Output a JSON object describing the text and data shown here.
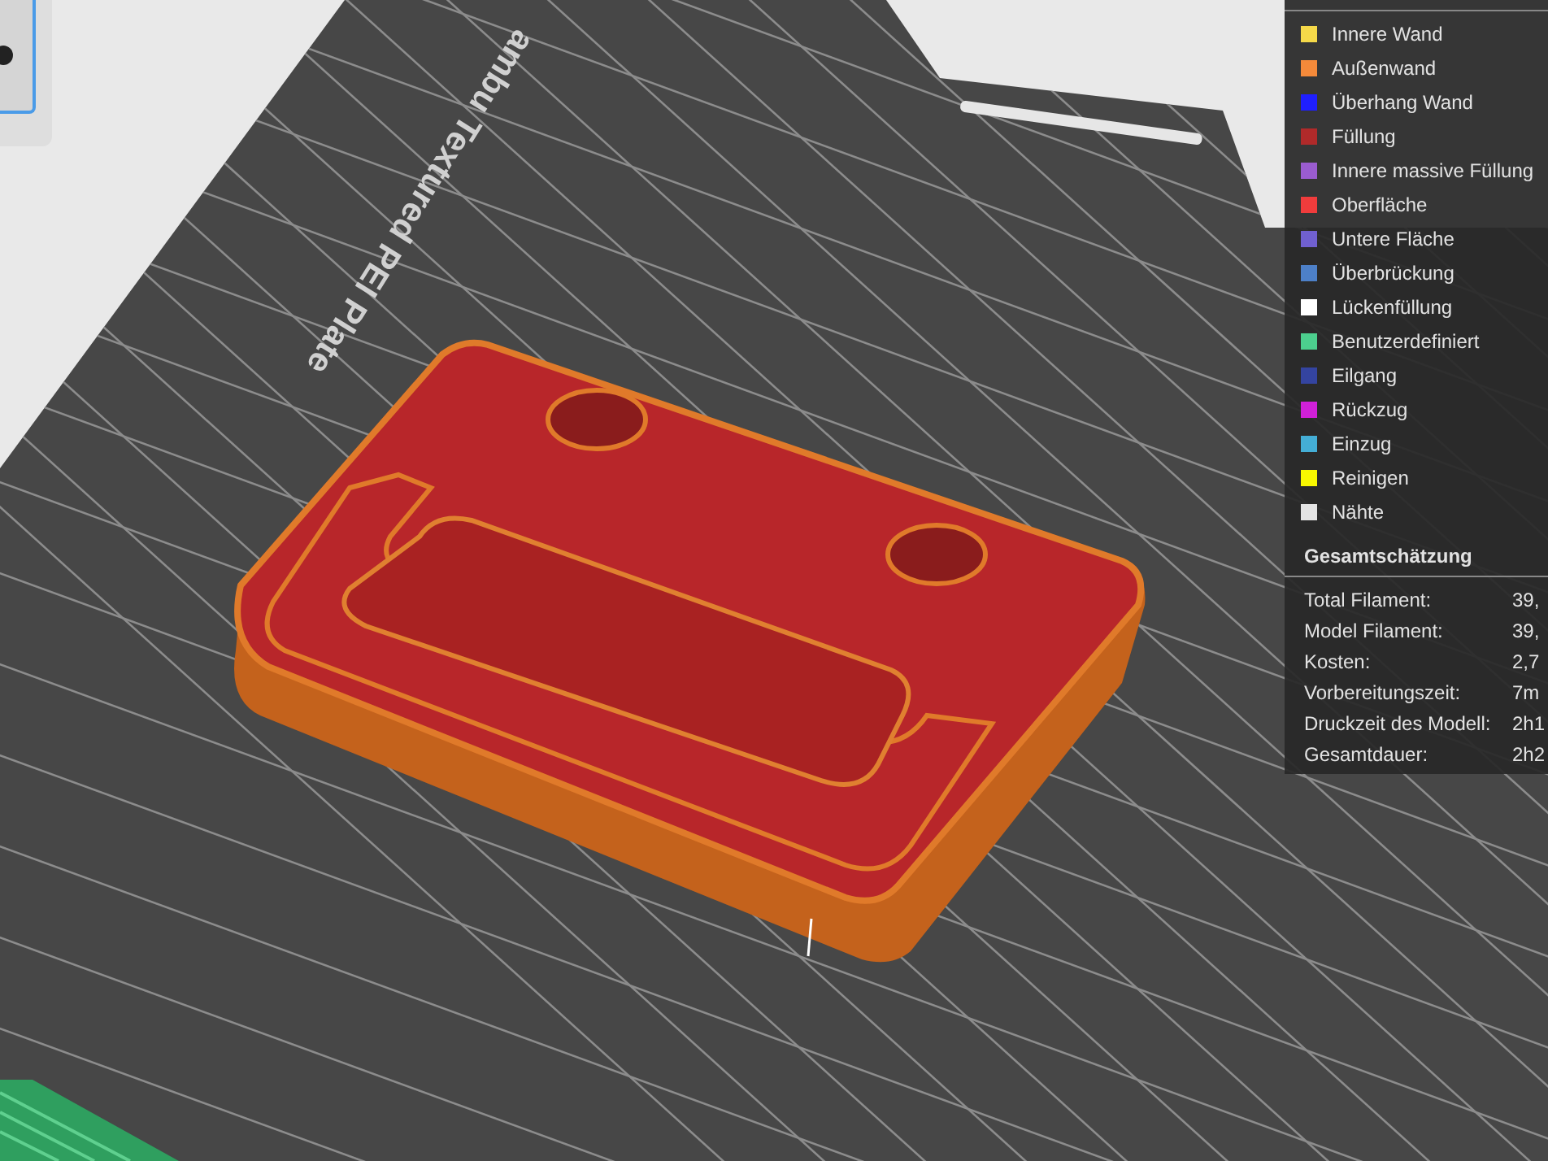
{
  "plate": {
    "label": "ambu Textured PEI Plate"
  },
  "legend": {
    "items": [
      {
        "label": "Innere Wand",
        "color": "#f5d949"
      },
      {
        "label": "Außenwand",
        "color": "#f58a3a"
      },
      {
        "label": "Überhang Wand",
        "color": "#1f1fff"
      },
      {
        "label": "Füllung",
        "color": "#b02a2a"
      },
      {
        "label": "Innere massive Füllung",
        "color": "#9a5cd0"
      },
      {
        "label": "Oberfläche",
        "color": "#f03c3c"
      },
      {
        "label": "Untere Fläche",
        "color": "#7060d0"
      },
      {
        "label": "Überbrückung",
        "color": "#4d80c8"
      },
      {
        "label": "Lückenfüllung",
        "color": "#ffffff"
      },
      {
        "label": "Benutzerdefiniert",
        "color": "#4ccf8e"
      },
      {
        "label": "Eilgang",
        "color": "#3444a0"
      },
      {
        "label": "Rückzug",
        "color": "#d020d8"
      },
      {
        "label": "Einzug",
        "color": "#44aed6"
      },
      {
        "label": "Reinigen",
        "color": "#f8f800"
      },
      {
        "label": "Nähte",
        "color": "#e4e4e4"
      }
    ]
  },
  "summary": {
    "title": "Gesamtschätzung",
    "rows": [
      {
        "label": "Total Filament:",
        "value": "39,"
      },
      {
        "label": "Model Filament:",
        "value": "39,"
      },
      {
        "label": "Kosten:",
        "value": "2,7"
      },
      {
        "label": "Vorbereitungszeit:",
        "value": "7m"
      },
      {
        "label": "Druckzeit des Modell:",
        "value": "2h1"
      },
      {
        "label": "Gesamtdauer:",
        "value": "2h2"
      }
    ]
  }
}
